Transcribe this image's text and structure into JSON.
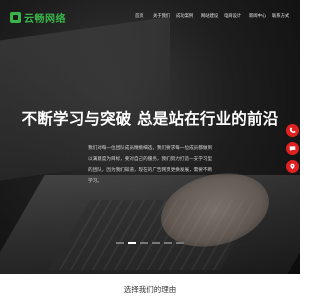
{
  "brand": {
    "name": "云畅网络"
  },
  "nav": {
    "items": [
      {
        "label": "首页"
      },
      {
        "label": "关于我们"
      },
      {
        "label": "成功案例"
      },
      {
        "label": "网站建设"
      },
      {
        "label": "电商设计"
      },
      {
        "label": "新闻中心"
      },
      {
        "label": "联系方式"
      }
    ]
  },
  "hero": {
    "headline": "不断学习与突破 总是站在行业的前沿",
    "intro": "我们对每一位团队成员精挑细选，我们要求每一位成员都做到以满意度为目标，要对自己的服务，我们努力打造一支学习型的团队，因为我们知道，现在的广告网页更换发展，需要不断学习。",
    "slide_count": 6,
    "active_slide": 1
  },
  "float_buttons": [
    {
      "icon": "phone-icon"
    },
    {
      "icon": "chat-icon"
    },
    {
      "icon": "location-icon"
    }
  ],
  "section": {
    "title": "选择我们的理由"
  },
  "colors": {
    "brand_green": "#39b54a",
    "float_red": "#e02121"
  }
}
